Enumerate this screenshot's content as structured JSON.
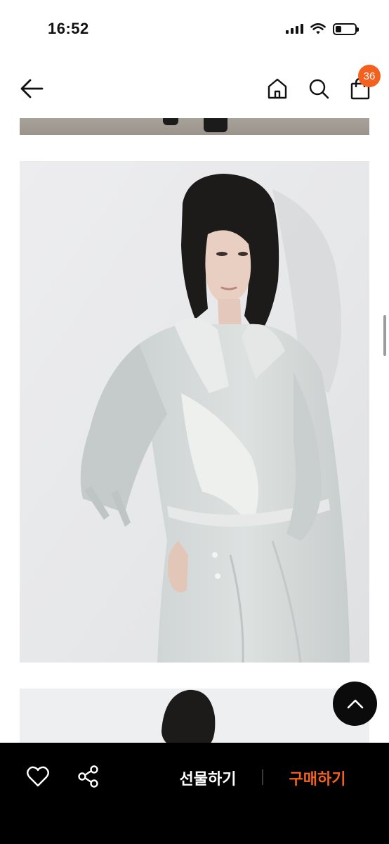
{
  "status_bar": {
    "time": "16:52",
    "signal_icon": "cellular-signal-icon",
    "wifi_icon": "wifi-icon",
    "battery_icon": "battery-icon",
    "battery_level": 0.3
  },
  "header": {
    "back_icon": "arrow-left-icon",
    "home_icon": "home-icon",
    "search_icon": "search-icon",
    "cart_icon": "shopping-bag-icon",
    "cart_count": "36",
    "badge_color": "#f2611f"
  },
  "content": {
    "main_image_icon": "product-photo-model-wearing-light-grey-trench-dress",
    "scroll_top_icon": "chevron-up-icon"
  },
  "bottom_bar": {
    "wishlist_icon": "heart-icon",
    "share_icon": "share-icon",
    "gift_label": "선물하기",
    "buy_label": "구매하기",
    "buy_color": "#f2611f"
  }
}
